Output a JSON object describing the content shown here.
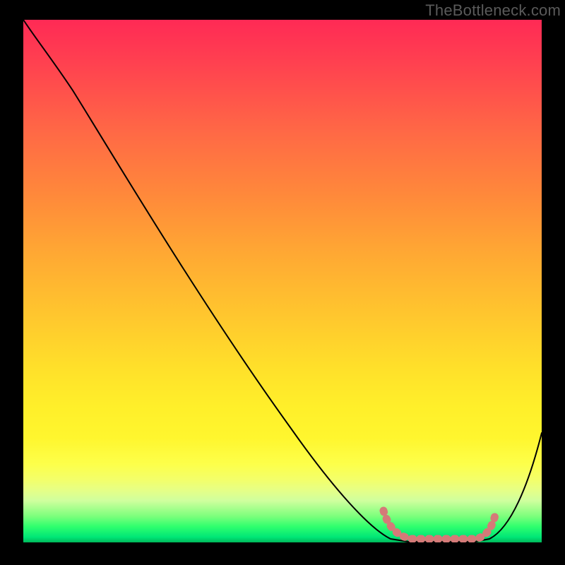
{
  "watermark": "TheBottleneck.com",
  "chart_data": {
    "type": "line",
    "title": "",
    "xlabel": "",
    "ylabel": "",
    "xlim": [
      0,
      100
    ],
    "ylim": [
      0,
      100
    ],
    "series": [
      {
        "name": "bottleneck-curve",
        "x": [
          0,
          6,
          12,
          20,
          30,
          40,
          50,
          58,
          62,
          66,
          70,
          74,
          78,
          82,
          86,
          90,
          94,
          100
        ],
        "y": [
          100,
          93,
          86,
          76,
          63,
          50,
          37,
          26,
          20,
          14,
          8,
          4,
          1,
          0,
          0,
          1,
          7,
          25
        ]
      }
    ],
    "trough": {
      "left_x": 70,
      "right_x": 90,
      "start_y": 6,
      "bottom_y": 0,
      "end_y": 4
    },
    "gradient_stops": [
      {
        "pos": 0,
        "color": "#ff2a55"
      },
      {
        "pos": 50,
        "color": "#ffc52e"
      },
      {
        "pos": 85,
        "color": "#fdff4a"
      },
      {
        "pos": 100,
        "color": "#00b85a"
      }
    ]
  }
}
